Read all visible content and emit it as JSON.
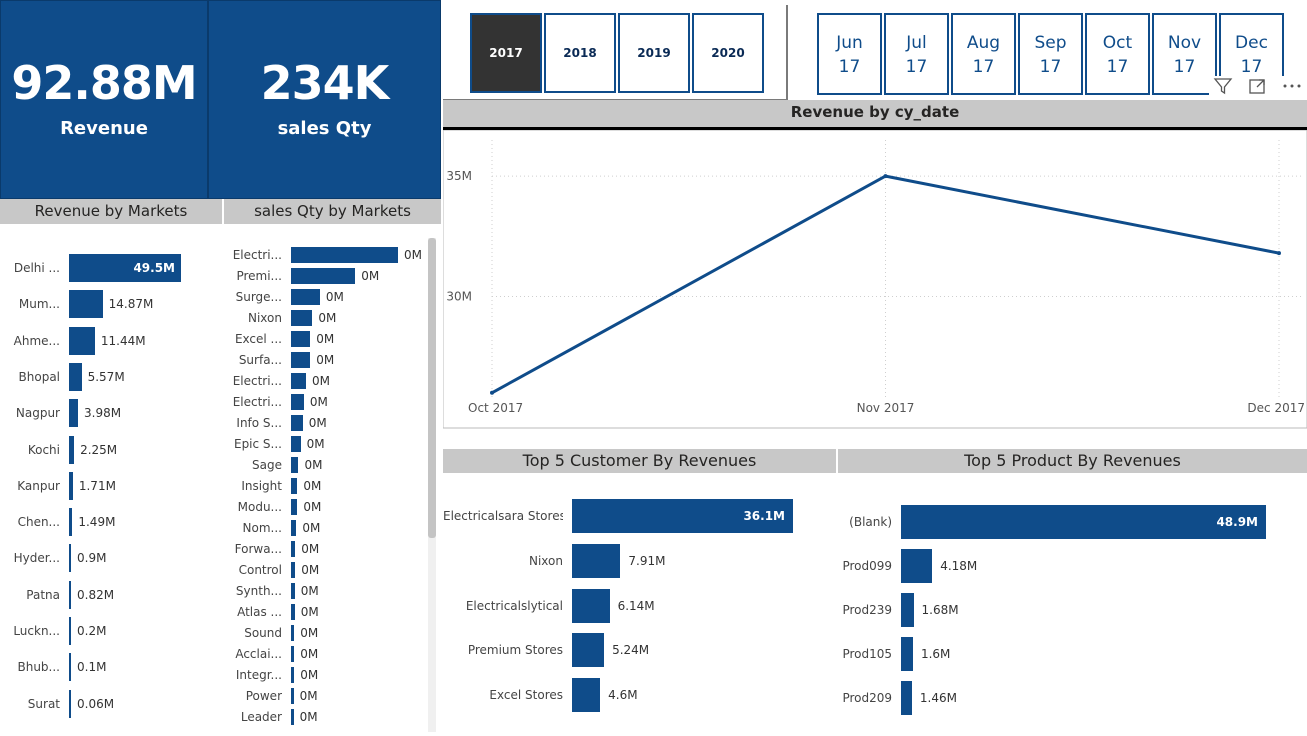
{
  "kpis": {
    "revenue": {
      "value": "92.88M",
      "label": "Revenue"
    },
    "qty": {
      "value": "234K",
      "label": "sales Qty"
    }
  },
  "years": [
    {
      "label": "2017",
      "selected": true
    },
    {
      "label": "2018",
      "selected": false
    },
    {
      "label": "2019",
      "selected": false
    },
    {
      "label": "2020",
      "selected": false
    }
  ],
  "months": [
    {
      "m": "Jun",
      "y": "17"
    },
    {
      "m": "Jul",
      "y": "17"
    },
    {
      "m": "Aug",
      "y": "17"
    },
    {
      "m": "Sep",
      "y": "17"
    },
    {
      "m": "Oct",
      "y": "17"
    },
    {
      "m": "Nov",
      "y": "17"
    },
    {
      "m": "Dec",
      "y": "17"
    }
  ],
  "toolbar": {
    "filter_icon": "filter-icon",
    "focus_icon": "focus-mode-icon",
    "more_icon": "more-options-icon"
  },
  "revenue_markets": {
    "title": "Revenue by Markets",
    "items": [
      {
        "label": "Delhi ...",
        "value": 49.5,
        "text": "49.5M"
      },
      {
        "label": "Mum...",
        "value": 14.87,
        "text": "14.87M"
      },
      {
        "label": "Ahme...",
        "value": 11.44,
        "text": "11.44M"
      },
      {
        "label": "Bhopal",
        "value": 5.57,
        "text": "5.57M"
      },
      {
        "label": "Nagpur",
        "value": 3.98,
        "text": "3.98M"
      },
      {
        "label": "Kochi",
        "value": 2.25,
        "text": "2.25M"
      },
      {
        "label": "Kanpur",
        "value": 1.71,
        "text": "1.71M"
      },
      {
        "label": "Chen...",
        "value": 1.49,
        "text": "1.49M"
      },
      {
        "label": "Hyder...",
        "value": 0.9,
        "text": "0.9M"
      },
      {
        "label": "Patna",
        "value": 0.82,
        "text": "0.82M"
      },
      {
        "label": "Luckn...",
        "value": 0.2,
        "text": "0.2M"
      },
      {
        "label": "Bhub...",
        "value": 0.1,
        "text": "0.1M"
      },
      {
        "label": "Surat",
        "value": 0.06,
        "text": "0.06M"
      }
    ]
  },
  "qty_markets": {
    "title": "sales Qty by Markets",
    "items": [
      {
        "label": "Electri...",
        "value": 100,
        "text": "0M"
      },
      {
        "label": "Premi...",
        "value": 60,
        "text": "0M"
      },
      {
        "label": "Surge...",
        "value": 27,
        "text": "0M"
      },
      {
        "label": "Nixon",
        "value": 20,
        "text": "0M"
      },
      {
        "label": "Excel ...",
        "value": 18,
        "text": "0M"
      },
      {
        "label": "Surfa...",
        "value": 18,
        "text": "0M"
      },
      {
        "label": "Electri...",
        "value": 14,
        "text": "0M"
      },
      {
        "label": "Electri...",
        "value": 12,
        "text": "0M"
      },
      {
        "label": "Info S...",
        "value": 11,
        "text": "0M"
      },
      {
        "label": "Epic S...",
        "value": 9,
        "text": "0M"
      },
      {
        "label": "Sage",
        "value": 7,
        "text": "0M"
      },
      {
        "label": "Insight",
        "value": 6,
        "text": "0M"
      },
      {
        "label": "Modu...",
        "value": 6,
        "text": "0M"
      },
      {
        "label": "Nom...",
        "value": 5,
        "text": "0M"
      },
      {
        "label": "Forwa...",
        "value": 4,
        "text": "0M"
      },
      {
        "label": "Control",
        "value": 4,
        "text": "0M"
      },
      {
        "label": "Synth...",
        "value": 3.5,
        "text": "0M"
      },
      {
        "label": "Atlas ...",
        "value": 3.5,
        "text": "0M"
      },
      {
        "label": "Sound",
        "value": 3,
        "text": "0M"
      },
      {
        "label": "Acclai...",
        "value": 3,
        "text": "0M"
      },
      {
        "label": "Integr...",
        "value": 3,
        "text": "0M"
      },
      {
        "label": "Power",
        "value": 2.5,
        "text": "0M"
      },
      {
        "label": "Leader",
        "value": 2.5,
        "text": "0M"
      }
    ]
  },
  "chart_data": [
    {
      "type": "line",
      "title": "Revenue by cy_date",
      "x": [
        "Oct 2017",
        "Nov 2017",
        "Dec 2017"
      ],
      "values": [
        26.0,
        35.0,
        31.8
      ],
      "ylim": [
        25.7,
        36.5
      ],
      "yticks": [
        {
          "value": 30,
          "label": "30M"
        },
        {
          "value": 35,
          "label": "35M"
        }
      ],
      "grid": true,
      "color": "#0f4c8a"
    },
    {
      "type": "bar",
      "title": "Top 5 Customer By Revenues",
      "categories": [
        "Electricalsara Stores",
        "Nixon",
        "Electricalslytical",
        "Premium Stores",
        "Excel Stores"
      ],
      "values": [
        36.1,
        7.91,
        6.14,
        5.24,
        4.6
      ],
      "labels": [
        "36.1M",
        "7.91M",
        "6.14M",
        "5.24M",
        "4.6M"
      ]
    },
    {
      "type": "bar",
      "title": "Top 5 Product By Revenues",
      "categories": [
        "(Blank)",
        "Prod099",
        "Prod239",
        "Prod105",
        "Prod209"
      ],
      "values": [
        48.9,
        4.18,
        1.68,
        1.6,
        1.46
      ],
      "labels": [
        "48.9M",
        "4.18M",
        "1.68M",
        "1.6M",
        "1.46M"
      ]
    }
  ],
  "colors": {
    "primary": "#0f4c8a",
    "header_gray": "#c8c8c8",
    "selected_btn": "#333333"
  }
}
